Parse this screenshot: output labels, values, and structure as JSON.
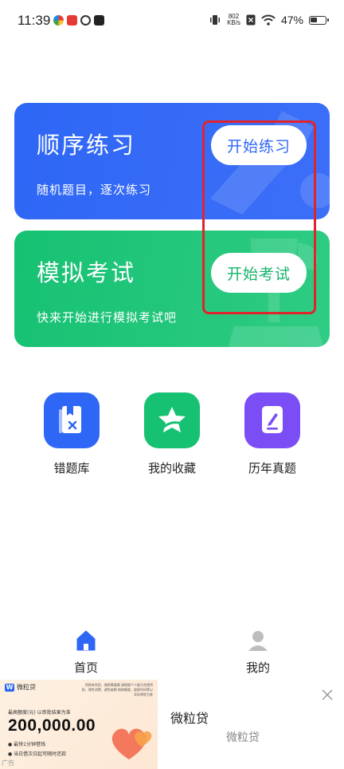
{
  "status_bar": {
    "time": "11:39",
    "net_speed_value": "802",
    "net_speed_unit": "KB/s",
    "battery": "47%",
    "battery_level": 0.47
  },
  "cards": {
    "practice": {
      "title": "顺序练习",
      "subtitle": "随机题目，逐次练习",
      "button": "开始练习",
      "color": "#2e66f5"
    },
    "exam": {
      "title": "模拟考试",
      "subtitle": "快来开始进行模拟考试吧",
      "button": "开始考试",
      "color": "#16c172"
    }
  },
  "features": [
    {
      "label": "错题库",
      "icon": "wrong-questions-icon",
      "color": "#2e66f5"
    },
    {
      "label": "我的收藏",
      "icon": "star-icon",
      "color": "#16c172"
    },
    {
      "label": "历年真题",
      "icon": "pen-document-icon",
      "color": "#7b4df5"
    }
  ],
  "bottom_nav": {
    "home": {
      "label": "首页",
      "icon": "home-icon",
      "active": true
    },
    "mine": {
      "label": "我的",
      "icon": "user-icon",
      "active": false
    }
  },
  "ad": {
    "brand": "微粒贷",
    "fine_print": "贷款有风险，借款需谨慎 请根据个人能力合理贷款，理性消费，避免逾期 借款额度、放款时间等以实际审批为准",
    "limit_label": "最高额度(元) 以审批结果为准",
    "amount": "200,000.00",
    "line1": "最快1分钟借钱",
    "line2": "当日借次日起可随时还款",
    "tag": "广告",
    "title": "微粒贷",
    "subtitle": "微粒贷"
  }
}
